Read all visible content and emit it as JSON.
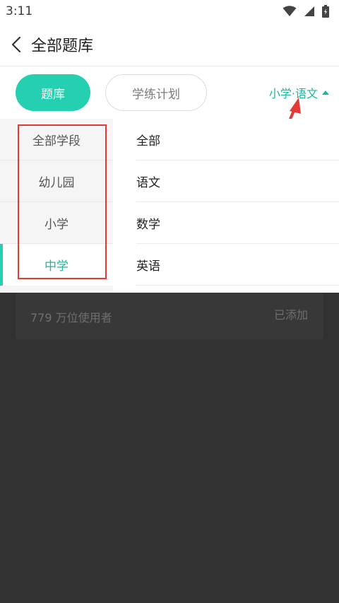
{
  "status_bar": {
    "time": "3:11",
    "icons": [
      "wifi-icon",
      "cellular-icon",
      "battery-icon"
    ]
  },
  "header": {
    "title": "全部题库",
    "back_icon": "chevron-left-icon"
  },
  "tabs": {
    "active": "题库",
    "inactive": "学练计划"
  },
  "filter": {
    "label": "小学·语文",
    "icon": "caret-up-icon"
  },
  "dropdown": {
    "stages": [
      {
        "label": "全部学段",
        "selected": false
      },
      {
        "label": "幼儿园",
        "selected": false
      },
      {
        "label": "小学",
        "selected": false
      },
      {
        "label": "中学",
        "selected": true
      }
    ],
    "subjects": [
      "全部",
      "语文",
      "数学",
      "英语"
    ]
  },
  "background_card": {
    "users": "779 万位使用者",
    "status": "已添加"
  },
  "colors": {
    "accent": "#25d0b1",
    "accent_text": "#1ab79c",
    "overlay": "#323232",
    "annotation": "#e53935"
  }
}
